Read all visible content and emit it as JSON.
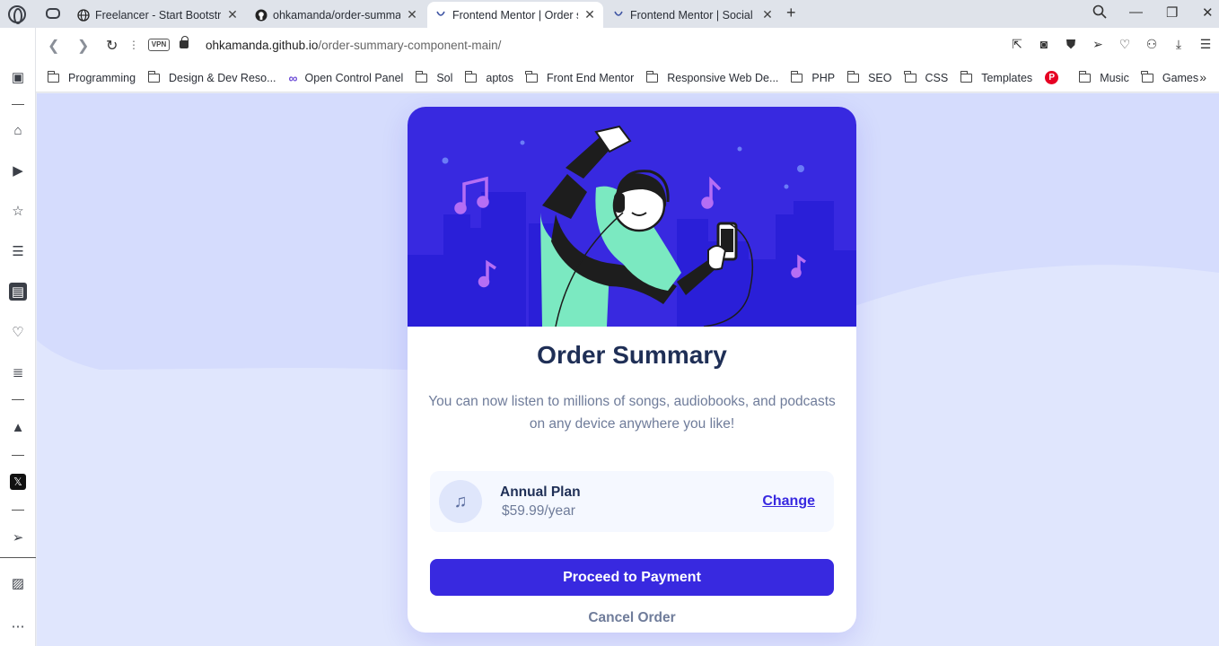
{
  "browser": {
    "tabs": [
      {
        "title": "Freelancer - Start Bootstrap",
        "icon": "globe-icon",
        "active": false
      },
      {
        "title": "ohkamanda/order-summary",
        "icon": "github-icon",
        "active": false
      },
      {
        "title": "Frontend Mentor | Order su",
        "icon": "frontend-mentor-icon",
        "active": true
      },
      {
        "title": "Frontend Mentor | Social lin",
        "icon": "frontend-mentor-icon",
        "active": false
      }
    ],
    "vpn_label": "VPN",
    "url_domain": "ohkamanda.github.io",
    "url_path": "/order-summary-component-main/",
    "bookmarks": [
      {
        "label": "Programming",
        "icon": "folder-icon"
      },
      {
        "label": "Design & Dev Reso...",
        "icon": "folder-icon"
      },
      {
        "label": "Open Control Panel",
        "icon": "infinity-icon"
      },
      {
        "label": "Sol",
        "icon": "folder-icon"
      },
      {
        "label": "aptos",
        "icon": "folder-icon"
      },
      {
        "label": "Front End Mentor",
        "icon": "folder-icon"
      },
      {
        "label": "Responsive Web De...",
        "icon": "folder-icon"
      },
      {
        "label": "PHP",
        "icon": "folder-icon"
      },
      {
        "label": "SEO",
        "icon": "folder-icon"
      },
      {
        "label": "CSS",
        "icon": "folder-icon"
      },
      {
        "label": "Templates",
        "icon": "folder-icon"
      },
      {
        "label": "",
        "icon": "pinterest-icon"
      },
      {
        "label": "Music",
        "icon": "folder-icon"
      },
      {
        "label": "Games",
        "icon": "folder-icon"
      }
    ]
  },
  "card": {
    "title": "Order Summary",
    "description": "You can now listen to millions of songs, audiobooks, and podcasts on any device anywhere you like!",
    "plan_name": "Annual Plan",
    "plan_price": "$59.99/year",
    "change_label": "Change",
    "pay_label": "Proceed to Payment",
    "cancel_label": "Cancel Order"
  },
  "colors": {
    "brand_blue": "#3829e0",
    "page_bg": "#e0e6fd",
    "title_navy": "#1f2f56",
    "muted_text": "#6f7c9a"
  }
}
